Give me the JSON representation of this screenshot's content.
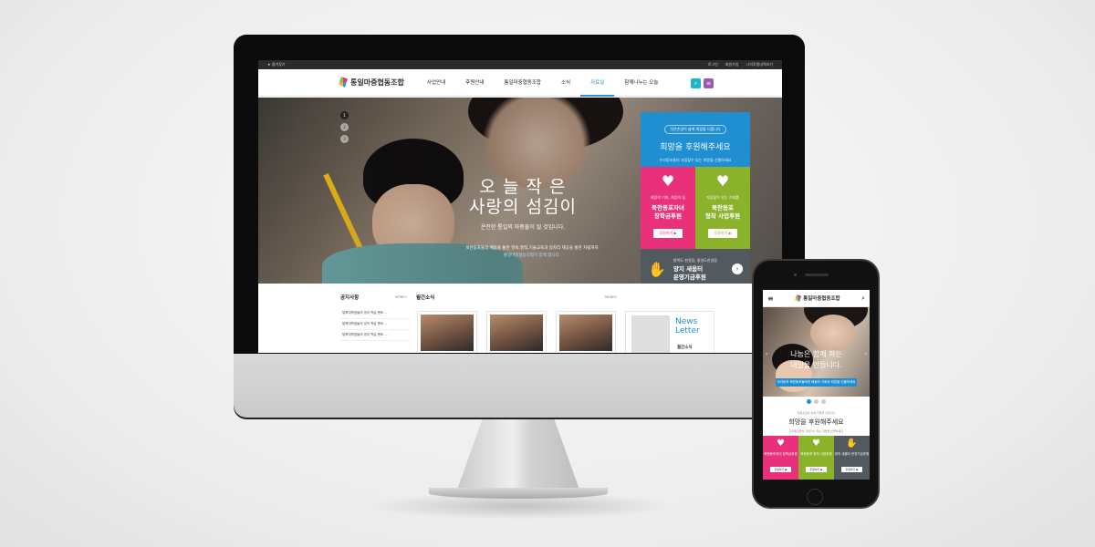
{
  "site": {
    "logo_text": "통일마중협동조합",
    "util_left": "★ 즐겨찾기",
    "util_right": [
      "로그인",
      "회원가입",
      "나의후원내역보기"
    ]
  },
  "nav": {
    "items": [
      "사업안내",
      "후원안내",
      "통일마중협동조합",
      "소식",
      "자료실",
      "함께나누는 오늘"
    ],
    "active_index": 4
  },
  "hero": {
    "slide_dots": [
      "1",
      "2",
      "3"
    ],
    "title_line1": "오 늘 작 은",
    "title_line2": "사랑의 섬김이",
    "subtitle": "온전한 통일의 마중물이 될 것입니다.",
    "desc_line1": "북한동포들의 배움을 통한 영육,영적,기술교육과 일자리 제공을 통한 자립까지",
    "desc_line2": "통일마중협동조합이 함께 합니다."
  },
  "support": {
    "pill": "작은손길이 삶에 희망을 더합니다",
    "heading": "희망을 후원해주세요",
    "subtext": "우리동포들이 자립할수 있는 희망을 선물하세요",
    "cards": [
      {
        "tag": "배움의 기회, 희망의 꿈",
        "name_line1": "북한동포자녀",
        "name_line2": "장학금후원",
        "button": "후원하기 ▶",
        "color": "#e8317a"
      },
      {
        "tag": "자립할수 있는 기회를",
        "name_line1": "북한동포",
        "name_line2": "정착 사업후원",
        "button": "후원하기 ▶",
        "color": "#8ab32b"
      }
    ],
    "bottom": {
      "tag": "탈북도 한걸음, 통일도한걸음",
      "name_line1": "양지 새움터",
      "name_line2": "운영기금후원",
      "color": "#52595f"
    }
  },
  "lower": {
    "notice_title": "공지사항",
    "notice_more": "MORE+",
    "notice_items": [
      "탈북대학생들의 영어 학습 멘토 ...",
      "탈북대학생들의 영어 학습 멘토 ...",
      "탈북대학생들의 영어 학습 멘토 ..."
    ],
    "monthly_title": "월간소식",
    "monthly_more": "MORE+",
    "newsletter_line1": "News",
    "newsletter_line2": "Letter",
    "newsletter_caption": "월간소식"
  },
  "mobile": {
    "hero_line1": "나눔은 함께 하는",
    "hero_line2": "내일을 만듭니다.",
    "hero_bar": "우리동포 북한동포들에게 배움의 기회와 희망을 선물하세요",
    "support_pill": "작은손길이 삶에 희망을 더합니다",
    "support_heading": "희망을 후원해주세요",
    "support_sub": "우리동포들이 자립할수 있는 희망을 선물하세요",
    "cards": [
      {
        "name": "북한동포자녀 장학금후원",
        "button": "후원하기 ▶",
        "color": "#e8317a"
      },
      {
        "name": "북한동포 정착 사업후원",
        "button": "후원하기 ▶",
        "color": "#8ab32b"
      },
      {
        "name": "양지 새움터 운영기금후원",
        "button": "후원하기 ▶",
        "color": "#52595f"
      }
    ]
  },
  "colors": {
    "accent": "#1f8fd2",
    "pink": "#e8317a",
    "green": "#8ab32b",
    "gray": "#52595f"
  }
}
